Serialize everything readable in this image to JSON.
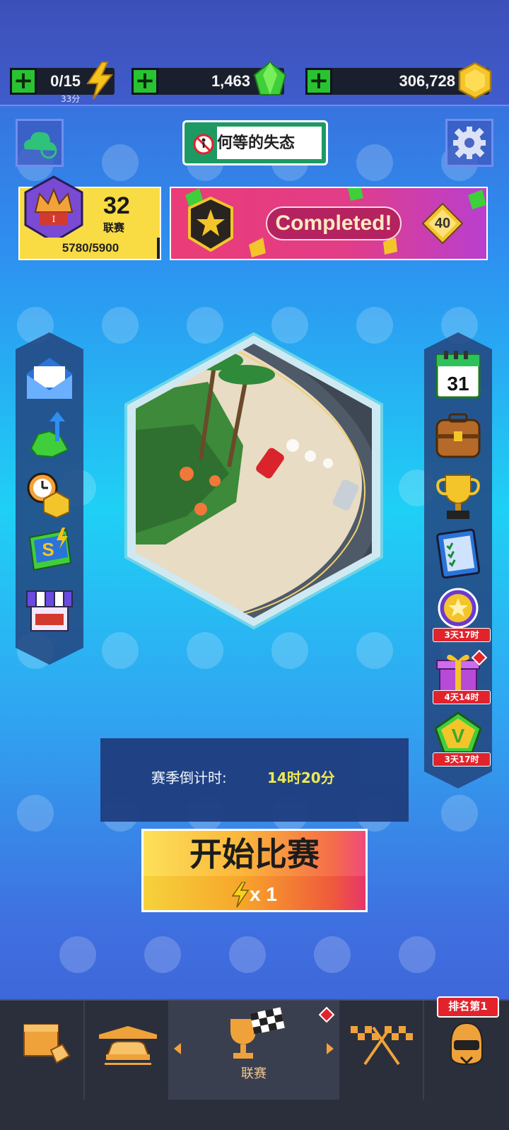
{
  "resources": {
    "energy": {
      "value": "0/15",
      "sub": "33分"
    },
    "gems": {
      "value": "1,463"
    },
    "coins": {
      "value": "306,728"
    }
  },
  "header": {
    "player_name": "何等的失态"
  },
  "league": {
    "number": "32",
    "label": "联赛",
    "progress_text": "5780/5900",
    "progress_fraction": 0.98
  },
  "quest": {
    "status": "Completed!",
    "reward": "40"
  },
  "left_menu": [
    "mail",
    "upgrade",
    "offer",
    "season-pass",
    "shop"
  ],
  "right_menu": {
    "calendar_day": "31",
    "timers": {
      "star_event": "3天17时",
      "gift": "4天14时",
      "vip": "3天17时"
    }
  },
  "countdown": {
    "label": "赛季倒计时:",
    "time": "14时20分"
  },
  "start_button": {
    "label": "开始比赛",
    "cost": "x 1"
  },
  "bottom_nav": {
    "active_label": "联赛",
    "rank_badge": "排名第1"
  },
  "colors": {
    "accent_green": "#29c332",
    "badge_red": "#e2232c",
    "timer_yellow": "#f8ee4a"
  }
}
